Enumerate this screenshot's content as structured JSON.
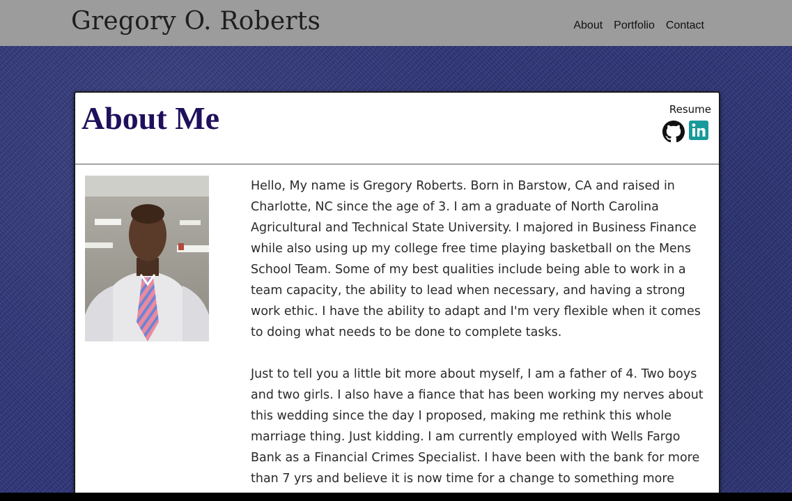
{
  "header": {
    "site_title": "Gregory O. Roberts",
    "nav": [
      {
        "label": "About"
      },
      {
        "label": "Portfolio"
      },
      {
        "label": "Contact"
      }
    ]
  },
  "about": {
    "title": "About Me",
    "resume_label": "Resume",
    "icons": [
      "github-icon",
      "linkedin-icon"
    ],
    "paragraphs": [
      "Hello, My name is Gregory Roberts. Born in Barstow, CA and raised in Charlotte, NC since the age of 3. I am a graduate of North Carolina Agricultural and Technical State University. I majored in Business Finance while also using up my college free time playing basketball on the Mens School Team. Some of my best qualities include being able to work in a team capacity, the ability to lead when necessary, and having a strong work ethic. I have the ability to adapt and I'm very flexible when it comes to doing what needs to be done to complete tasks.",
      "Just to tell you a little bit more about myself, I am a father of 4. Two boys and two girls. I also have a fiance that has been working my nerves about this wedding since the day I proposed, making me rethink this whole marriage thing. Just kidding. I am currently employed with Wells Fargo Bank as a Financial Crimes Specialist. I have been with the bank for more than 7 yrs and believe it is now time for a change to something more"
    ]
  },
  "colors": {
    "header_bg": "#9c9c9c",
    "page_bg": "#2e3576",
    "title_color": "#1f0f5c",
    "linkedin": "#1a9a9a"
  }
}
